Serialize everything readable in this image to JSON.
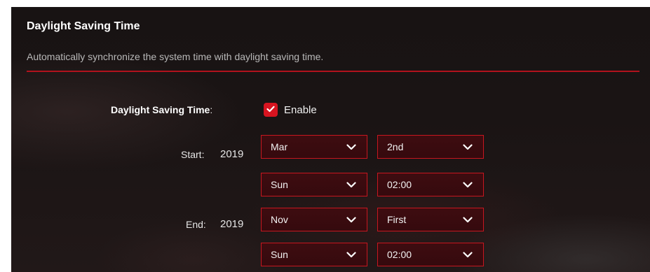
{
  "section": {
    "title": "Daylight Saving Time",
    "description": "Automatically synchronize the system time with daylight saving time."
  },
  "dst": {
    "label": "Daylight Saving Time",
    "colon": ":",
    "enable_label": "Enable",
    "enabled": true
  },
  "start": {
    "label": "Start:",
    "year": "2019",
    "month": "Mar",
    "week": "2nd",
    "day": "Sun",
    "time": "02:00"
  },
  "end": {
    "label": "End:",
    "year": "2019",
    "month": "Nov",
    "week": "First",
    "day": "Sun",
    "time": "02:00"
  },
  "colors": {
    "accent": "#d71420",
    "divider": "#b1121d",
    "select_bg": "#3e0c10"
  },
  "icons": {
    "checkbox": "checkmark-icon",
    "select_arrow": "chevron-down-icon"
  }
}
